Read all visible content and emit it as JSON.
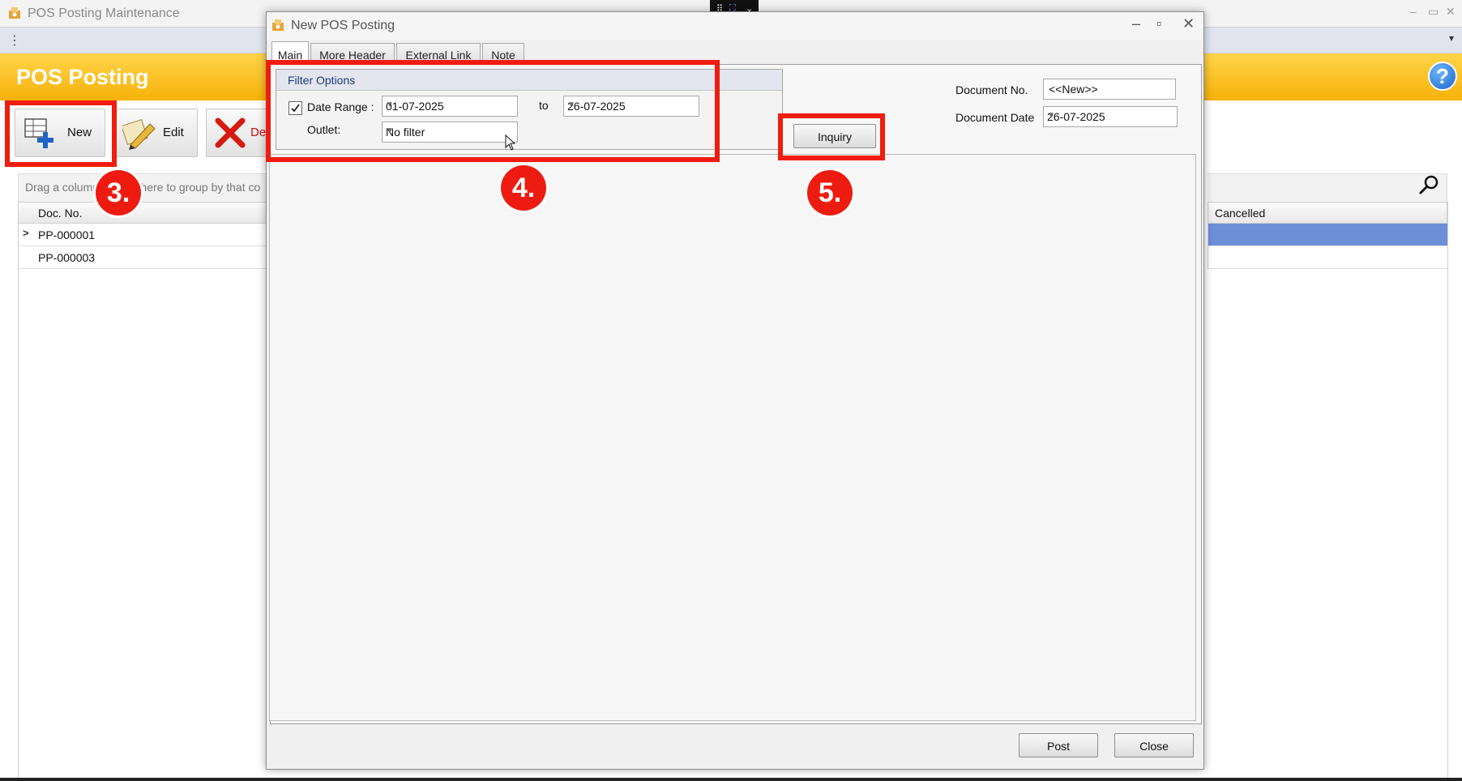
{
  "main_window": {
    "title": "POS Posting Maintenance",
    "banner_title": "POS Posting",
    "help_label": "?",
    "toolbar": {
      "new_label": "New",
      "edit_label": "Edit",
      "delete_label": "De"
    },
    "group_hint": "Drag a column header here to group by that co",
    "grid": {
      "columns": [
        "Doc. No.",
        "Cancelled"
      ],
      "rows": [
        {
          "doc_no": "PP-000001",
          "selected": true
        },
        {
          "doc_no": "PP-000003",
          "selected": false
        }
      ]
    }
  },
  "dialog": {
    "title": "New POS Posting",
    "tabs": [
      "Main",
      "More Header",
      "External Link",
      "Note"
    ],
    "active_tab": "Main",
    "filter_options": {
      "title": "Filter Options",
      "date_range_label": "Date Range :",
      "date_range_checked": true,
      "date_from": "01-07-2025",
      "to_label": "to",
      "date_to": "26-07-2025",
      "outlet_label": "Outlet:",
      "outlet_value": "No filter"
    },
    "inquiry_label": "Inquiry",
    "document_no_label": "Document No.",
    "document_no_value": "<<New>>",
    "document_date_label": "Document Date",
    "document_date_value": "26-07-2025",
    "post_label": "Post",
    "close_label": "Close"
  },
  "annotations": {
    "step3": "3.",
    "step4": "4.",
    "step5": "5."
  },
  "colors": {
    "banner": "#f6b10a",
    "highlight": "#f01c0e",
    "selected_row": "#6d8fd8"
  }
}
